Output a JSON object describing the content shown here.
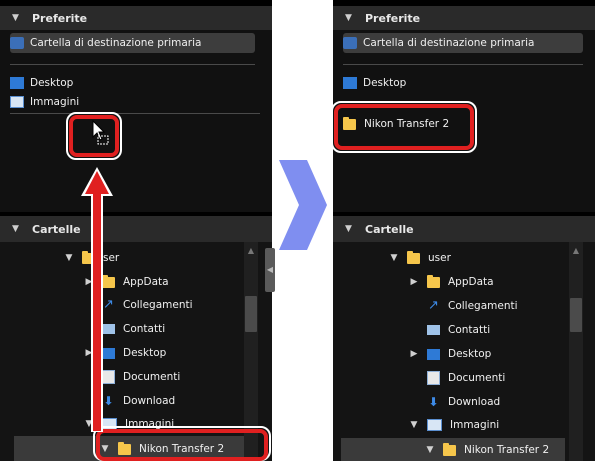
{
  "left": {
    "favorites_title": "Preferite",
    "primary_destination": "Cartella di destinazione primaria",
    "fav_items": [
      "Desktop",
      "Immagini"
    ],
    "folders_title": "Cartelle",
    "tree": [
      {
        "label": "ser",
        "arrow": "▼",
        "icon": "folder"
      },
      {
        "label": "AppData",
        "arrow": "▶",
        "icon": "folder"
      },
      {
        "label": "Collegamenti",
        "arrow": "",
        "icon": "link"
      },
      {
        "label": "Contatti",
        "arrow": "",
        "icon": "card"
      },
      {
        "label": "Desktop",
        "arrow": "▶",
        "icon": "blue"
      },
      {
        "label": "Documenti",
        "arrow": "",
        "icon": "doc"
      },
      {
        "label": "Download",
        "arrow": "",
        "icon": "download"
      },
      {
        "label": "Immagini",
        "arrow": "▼",
        "icon": "image"
      },
      {
        "label": "Nikon Transfer 2",
        "arrow": "▼",
        "icon": "folder"
      }
    ]
  },
  "right": {
    "favorites_title": "Preferite",
    "primary_destination": "Cartella di destinazione primaria",
    "fav_items": [
      "Desktop"
    ],
    "new_fav": "Nikon Transfer 2",
    "folders_title": "Cartelle",
    "tree": [
      {
        "label": "user",
        "arrow": "▼",
        "icon": "folder"
      },
      {
        "label": "AppData",
        "arrow": "▶",
        "icon": "folder"
      },
      {
        "label": "Collegamenti",
        "arrow": "",
        "icon": "link"
      },
      {
        "label": "Contatti",
        "arrow": "",
        "icon": "card"
      },
      {
        "label": "Desktop",
        "arrow": "▶",
        "icon": "blue"
      },
      {
        "label": "Documenti",
        "arrow": "",
        "icon": "doc"
      },
      {
        "label": "Download",
        "arrow": "",
        "icon": "download"
      },
      {
        "label": "Immagini",
        "arrow": "▼",
        "icon": "image"
      },
      {
        "label": "Nikon Transfer 2",
        "arrow": "▼",
        "icon": "folder"
      }
    ]
  },
  "colors": {
    "highlight_red": "#e02020",
    "transition_arrow": "#7f8ef0",
    "panel_bg": "#000000"
  },
  "icons": {
    "collapse": "triangle-down-icon",
    "expand": "triangle-right-icon",
    "cursor": "drag-cursor-icon"
  }
}
